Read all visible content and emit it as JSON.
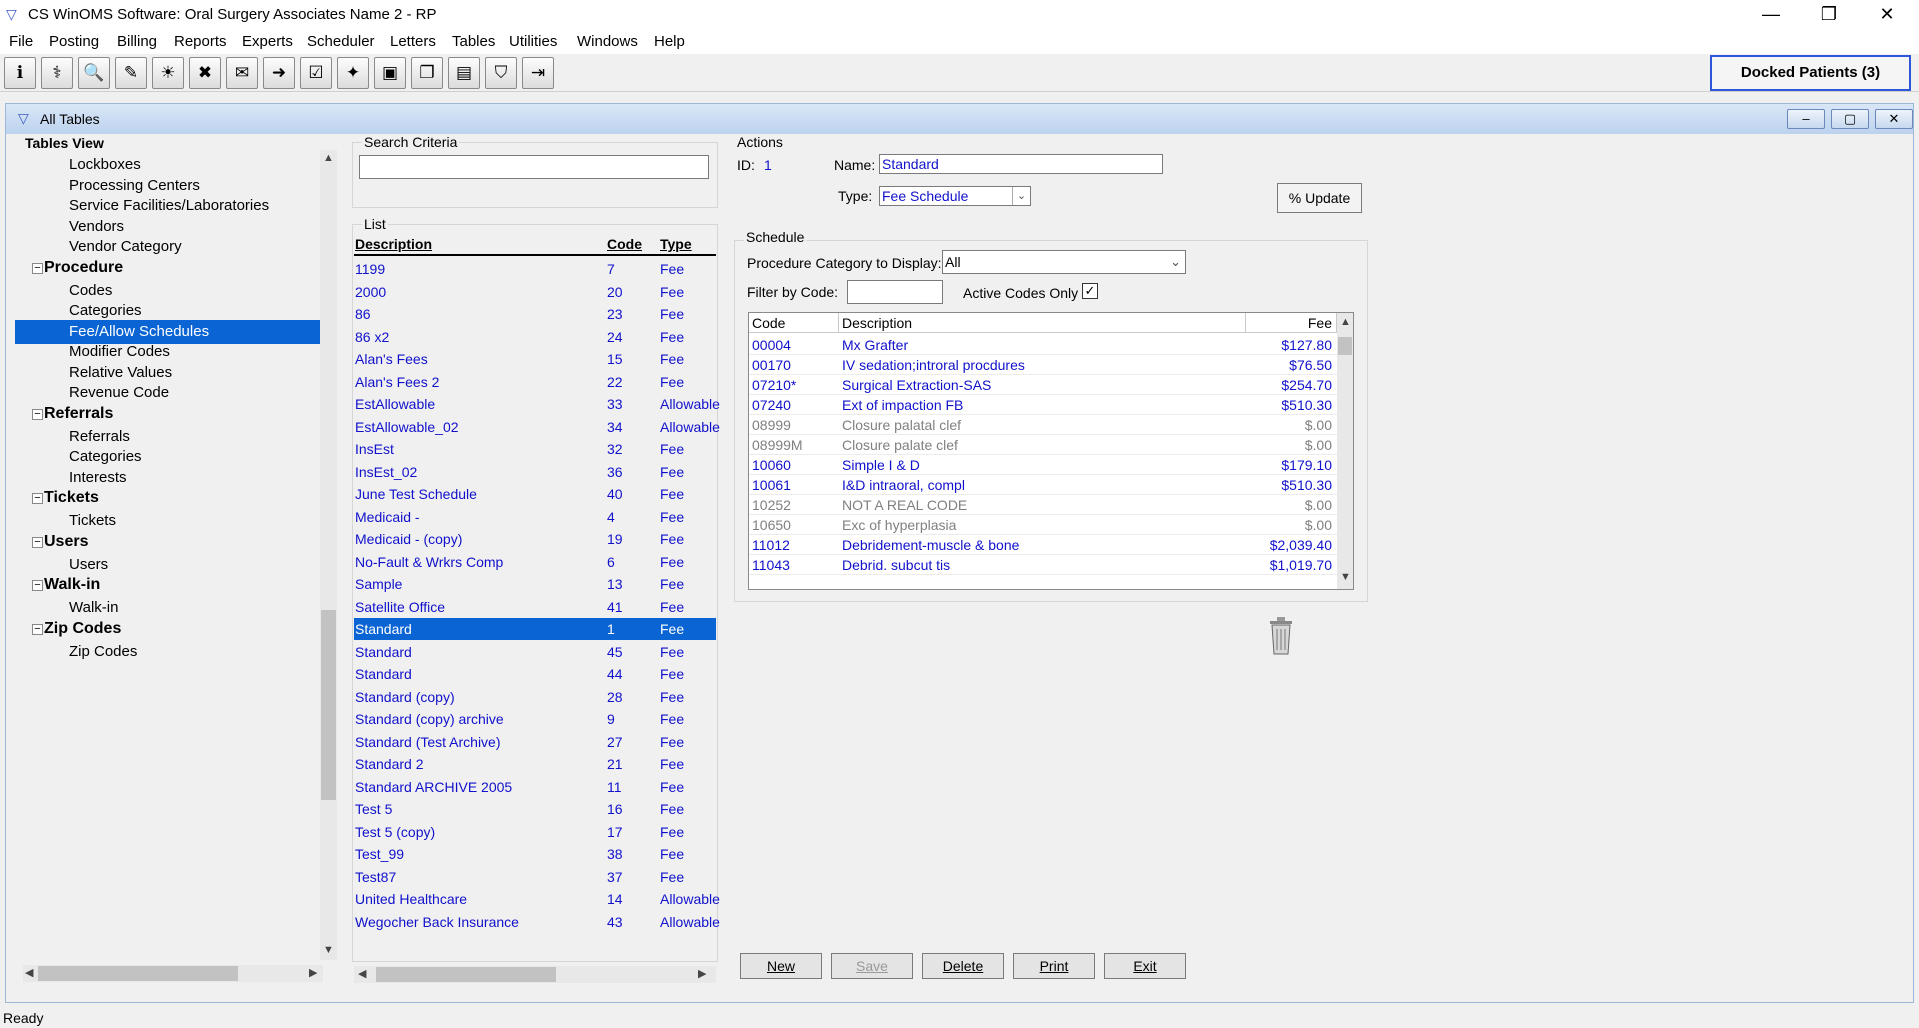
{
  "window": {
    "title": "CS WinOMS Software:  Oral Surgery Associates Name 2 - RP",
    "minimize": "—",
    "restore": "❐",
    "close": "✕"
  },
  "menu": [
    "File",
    "Posting",
    "Billing",
    "Reports",
    "Experts",
    "Scheduler",
    "Letters",
    "Tables",
    "Utilities",
    "Windows",
    "Help"
  ],
  "toolbar": {
    "icons": [
      "info-icon",
      "tree-icon",
      "search-icon",
      "chart-icon",
      "sun-icon",
      "tooth-icon",
      "letter-icon",
      "door-in-icon",
      "checklist-icon",
      "folder-icon",
      "monitor-icon",
      "window-icon",
      "document-icon",
      "patient-icon",
      "exit-icon"
    ],
    "glyphs": [
      "ℹ",
      "⚕",
      "🔍",
      "✎",
      "☀",
      "✖",
      "✉",
      "➜",
      "☑",
      "✦",
      "▣",
      "❐",
      "▤",
      "⛉",
      "⇥"
    ],
    "docked_label": "Docked Patients (3)"
  },
  "inner_window": {
    "title": "All Tables",
    "min": "–",
    "max": "▢",
    "close": "✕"
  },
  "tree": {
    "title": "Tables View",
    "rows": [
      {
        "label": "Lockboxes",
        "level": 2
      },
      {
        "label": "Processing Centers",
        "level": 2
      },
      {
        "label": "Service Facilities/Laboratories",
        "level": 2
      },
      {
        "label": "Vendors",
        "level": 2
      },
      {
        "label": "Vendor Category",
        "level": 2
      },
      {
        "label": "Procedure",
        "level": 1
      },
      {
        "label": "Codes",
        "level": 2
      },
      {
        "label": "Categories",
        "level": 2
      },
      {
        "label": "Fee/Allow Schedules",
        "level": 2,
        "selected": true
      },
      {
        "label": "Modifier Codes",
        "level": 2
      },
      {
        "label": "Relative Values",
        "level": 2
      },
      {
        "label": "Revenue Code",
        "level": 2
      },
      {
        "label": "Referrals",
        "level": 1
      },
      {
        "label": "Referrals",
        "level": 2
      },
      {
        "label": "Categories",
        "level": 2
      },
      {
        "label": "Interests",
        "level": 2
      },
      {
        "label": "Tickets",
        "level": 1
      },
      {
        "label": "Tickets",
        "level": 2
      },
      {
        "label": "Users",
        "level": 1
      },
      {
        "label": "Users",
        "level": 2
      },
      {
        "label": "Walk-in",
        "level": 1
      },
      {
        "label": "Walk-in",
        "level": 2
      },
      {
        "label": "Zip Codes",
        "level": 1
      },
      {
        "label": "Zip Codes",
        "level": 2
      }
    ]
  },
  "search": {
    "label": "Search Criteria",
    "value": ""
  },
  "list": {
    "label": "List",
    "headers": {
      "description": "Description",
      "code": "Code",
      "type": "Type"
    },
    "rows": [
      [
        "1199",
        "7",
        "Fee"
      ],
      [
        "2000",
        "20",
        "Fee"
      ],
      [
        "86",
        "23",
        "Fee"
      ],
      [
        "86 x2",
        "24",
        "Fee"
      ],
      [
        "Alan's Fees",
        "15",
        "Fee"
      ],
      [
        "Alan's Fees 2",
        "22",
        "Fee"
      ],
      [
        "EstAllowable",
        "33",
        "Allowable"
      ],
      [
        "EstAllowable_02",
        "34",
        "Allowable"
      ],
      [
        "InsEst",
        "32",
        "Fee"
      ],
      [
        "InsEst_02",
        "36",
        "Fee"
      ],
      [
        "June Test Schedule",
        "40",
        "Fee"
      ],
      [
        "Medicaid -",
        "4",
        "Fee"
      ],
      [
        "Medicaid - (copy)",
        "19",
        "Fee"
      ],
      [
        "No-Fault & Wrkrs Comp",
        "6",
        "Fee"
      ],
      [
        "Sample",
        "13",
        "Fee"
      ],
      [
        "Satellite Office",
        "41",
        "Fee"
      ],
      [
        "Standard",
        "1",
        "Fee"
      ],
      [
        "Standard",
        "45",
        "Fee"
      ],
      [
        "Standard",
        "44",
        "Fee"
      ],
      [
        "Standard (copy)",
        "28",
        "Fee"
      ],
      [
        "Standard (copy) archive",
        "9",
        "Fee"
      ],
      [
        "Standard (Test Archive)",
        "27",
        "Fee"
      ],
      [
        "Standard 2",
        "21",
        "Fee"
      ],
      [
        "Standard ARCHIVE 2005",
        "11",
        "Fee"
      ],
      [
        "Test 5",
        "16",
        "Fee"
      ],
      [
        "Test 5 (copy)",
        "17",
        "Fee"
      ],
      [
        "Test_99",
        "38",
        "Fee"
      ],
      [
        "Test87",
        "37",
        "Fee"
      ],
      [
        "United Healthcare",
        "14",
        "Allowable"
      ],
      [
        "Wegocher Back Insurance",
        "43",
        "Allowable"
      ]
    ],
    "selected_index": 16
  },
  "actions": {
    "label": "Actions",
    "id_label": "ID:",
    "id_value": "1",
    "name_label": "Name:",
    "name_value": "Standard",
    "type_label": "Type:",
    "type_value": "Fee Schedule",
    "update_button": "% Update"
  },
  "schedule": {
    "label": "Schedule",
    "category_label": "Procedure Category to Display:",
    "category_value": "All",
    "filter_label": "Filter by Code:",
    "filter_value": "",
    "active_only_label": "Active Codes Only",
    "active_only_checked": "✓",
    "headers": {
      "code": "Code",
      "description": "Description",
      "fee": "Fee"
    },
    "rows": [
      {
        "code": "00004",
        "description": "Mx Grafter",
        "fee": "$127.80",
        "active": true
      },
      {
        "code": "00170",
        "description": "IV sedation;introral procdures",
        "fee": "$76.50",
        "active": true
      },
      {
        "code": "07210*",
        "description": "Surgical Extraction-SAS",
        "fee": "$254.70",
        "active": true
      },
      {
        "code": "07240",
        "description": "Ext of impaction FB",
        "fee": "$510.30",
        "active": true
      },
      {
        "code": "08999",
        "description": "Closure palatal clef",
        "fee": "$.00",
        "active": false
      },
      {
        "code": "08999M",
        "description": "Closure palate clef",
        "fee": "$.00",
        "active": false
      },
      {
        "code": "10060",
        "description": "Simple I & D",
        "fee": "$179.10",
        "active": true
      },
      {
        "code": "10061",
        "description": "I&D intraoral, compl",
        "fee": "$510.30",
        "active": true
      },
      {
        "code": "10252",
        "description": "NOT A REAL CODE",
        "fee": "$.00",
        "active": false
      },
      {
        "code": "10650",
        "description": "Exc of hyperplasia",
        "fee": "$.00",
        "active": false
      },
      {
        "code": "11012",
        "description": "Debridement-muscle & bone",
        "fee": "$2,039.40",
        "active": true
      },
      {
        "code": "11043",
        "description": "Debrid. subcut tis",
        "fee": "$1,019.70",
        "active": true
      }
    ]
  },
  "buttons": {
    "new": "New",
    "save": "Save",
    "delete": "Delete",
    "print": "Print",
    "exit": "Exit"
  },
  "status": "Ready",
  "colors": {
    "selection": "#0a64d4",
    "link_text": "#1111cc",
    "docked_border": "#2b57d8"
  }
}
